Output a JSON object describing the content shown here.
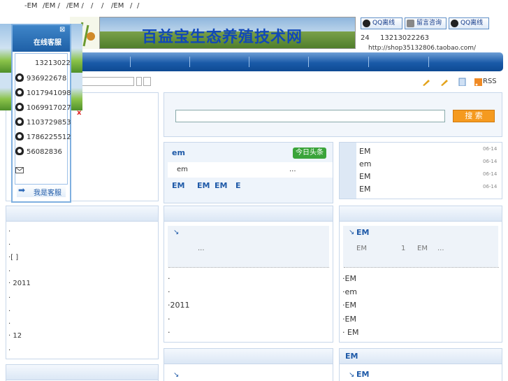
{
  "topnav": {
    "items": [
      "-EM",
      "/EM /",
      "/EM /",
      "/",
      "/",
      "/EM",
      "/",
      "/"
    ]
  },
  "header": {
    "site_title": "百益宝生态养殖技术网",
    "qq1": "QQ离线",
    "msg": "留言咨询",
    "qq2": "QQ离线",
    "line1_a": "24",
    "line1_b": "13213022263",
    "shop_url": "http://shop35132806.taobao.com/"
  },
  "float": {
    "title": "在线客服",
    "close": "⊠",
    "phone": "13213022",
    "qq": [
      "936922678",
      "1017941098",
      "1069917027",
      "1103729853",
      "1786225512",
      "56082836"
    ],
    "service": "我是客服"
  },
  "left": {
    "x": "x",
    "items": [
      ".",
      ".",
      "·[ ]",
      ".",
      "· 2011",
      ".",
      ".",
      ".",
      "· 12",
      "."
    ]
  },
  "search": {
    "button": "搜 索"
  },
  "toolbar": {
    "rss": "RSS"
  },
  "headline": {
    "title": "em",
    "badge": "今日头条",
    "sub": "em",
    "ellipsis": "...",
    "links": [
      "EM",
      "EM",
      "EM",
      "E"
    ]
  },
  "news": {
    "items": [
      {
        "t": "EM",
        "d": "06-14"
      },
      {
        "t": "em",
        "d": "06-14"
      },
      {
        "t": "EM",
        "d": "06-14"
      },
      {
        "t": "EM",
        "d": "06-14"
      }
    ]
  },
  "mid1": {
    "ellipsis": "...",
    "items": [
      "·",
      "·",
      "·2011",
      "·",
      "·"
    ]
  },
  "right1": {
    "title": "EM",
    "sub_a": "EM",
    "sub_b": "1",
    "sub_c": "EM",
    "ellipsis": "...",
    "items": [
      "·EM",
      "·em",
      "·EM",
      "·EM",
      "·      EM"
    ]
  },
  "right2": {
    "title": "EM",
    "sub": "EM"
  },
  "colors": {
    "accent": "#1f5aa8",
    "search_btn": "#f59a1f",
    "badge": "#3aa43a"
  }
}
